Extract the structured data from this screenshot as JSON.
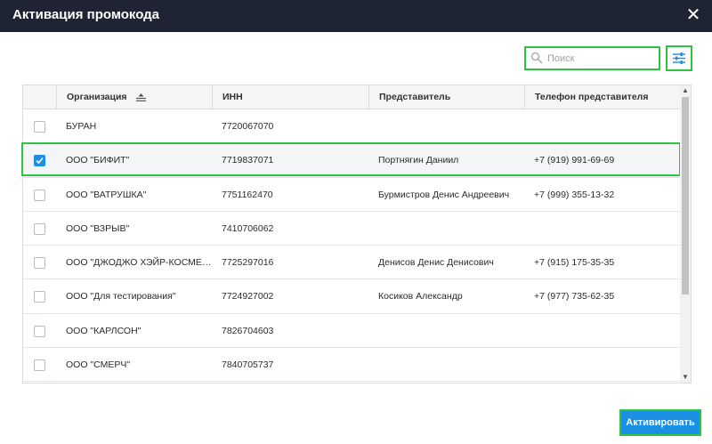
{
  "dialog": {
    "title": "Активация промокода",
    "close_glyph": "✕"
  },
  "search": {
    "placeholder": "Поиск",
    "value": ""
  },
  "filter": {
    "icon": "sliders-icon"
  },
  "table": {
    "columns": [
      "Организация",
      "ИНН",
      "Представитель",
      "Телефон представителя"
    ],
    "sort_column": "Организация",
    "rows": [
      {
        "checked": false,
        "org": "БУРАН",
        "inn": "7720067070",
        "rep": "",
        "phone": ""
      },
      {
        "checked": true,
        "org": "ООО \"БИФИТ\"",
        "inn": "7719837071",
        "rep": "Портнягин Даниил",
        "phone": "+7 (919) 991-69-69"
      },
      {
        "checked": false,
        "org": "ООО \"ВАТРУШКА\"",
        "inn": "7751162470",
        "rep": "Бурмистров Денис Андреевич",
        "phone": "+7 (999) 355-13-32"
      },
      {
        "checked": false,
        "org": "ООО \"ВЗРЫВ\"",
        "inn": "7410706062",
        "rep": "",
        "phone": ""
      },
      {
        "checked": false,
        "org": "ООО \"ДЖОДЖО ХЭЙР-КОСМЕТИ…",
        "inn": "7725297016",
        "rep": "Денисов Денис Денисович",
        "phone": "+7 (915) 175-35-35"
      },
      {
        "checked": false,
        "org": "ООО \"Для тестирования\"",
        "inn": "7724927002",
        "rep": "Косиков Александр",
        "phone": "+7 (977) 735-62-35"
      },
      {
        "checked": false,
        "org": "ООО \"КАРЛСОН\"",
        "inn": "7826704603",
        "rep": "",
        "phone": ""
      },
      {
        "checked": false,
        "org": "ООО \"СМЕРЧ\"",
        "inn": "7840705737",
        "rep": "",
        "phone": ""
      }
    ]
  },
  "actions": {
    "activate_label": "Активировать"
  },
  "colors": {
    "header_bg": "#1e2433",
    "accent_blue": "#1a8fe3",
    "highlight_green": "#2fc43f"
  }
}
